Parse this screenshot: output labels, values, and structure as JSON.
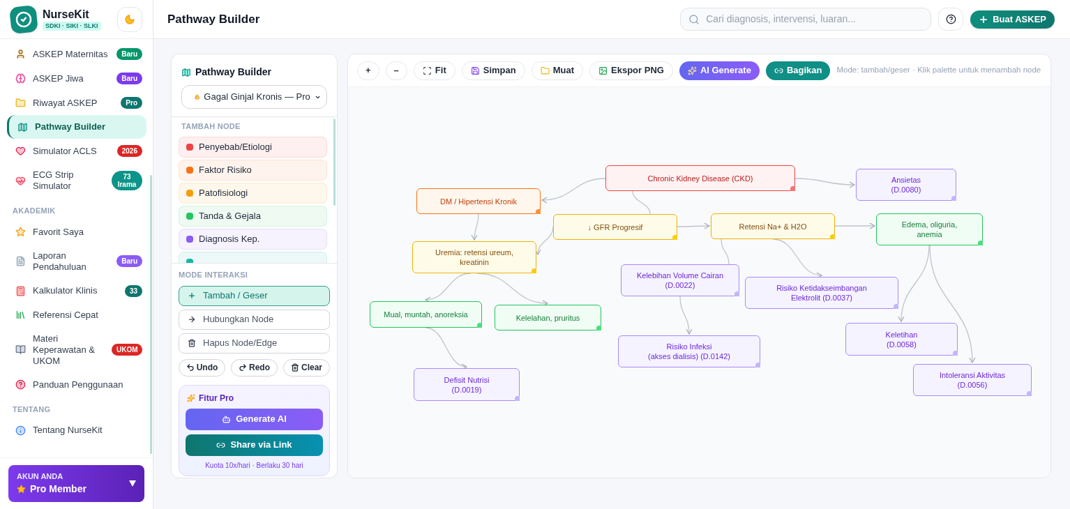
{
  "brand": {
    "name": "NurseKit",
    "tagline": "SDKI · SIKI · SLKI"
  },
  "sidebar": {
    "sections": [
      {
        "items": [
          {
            "label": "ASKEP Maternitas",
            "selected": false,
            "badge": {
              "text": "Baru",
              "color": "#059669"
            }
          },
          {
            "label": "ASKEP Jiwa",
            "selected": false,
            "badge": {
              "text": "Baru",
              "color": "#7c3aed"
            }
          },
          {
            "label": "Riwayat ASKEP",
            "selected": false,
            "badge": {
              "text": "Pro",
              "color": "#0f766e"
            }
          },
          {
            "label": "Pathway Builder",
            "selected": true
          },
          {
            "label": "Simulator ACLS",
            "selected": false,
            "badge": {
              "text": "2026",
              "color": "#dc2626"
            }
          },
          {
            "label": "ECG Strip Simulator",
            "selected": false,
            "badge": {
              "text": "73 Irama",
              "color": "#0d9488"
            }
          }
        ]
      },
      {
        "heading": "AKADEMIK",
        "items": [
          {
            "label": "Favorit Saya",
            "selected": false
          },
          {
            "label": "Laporan Pendahuluan",
            "selected": false,
            "badge": {
              "text": "Baru",
              "color": "#8b5cf6"
            }
          },
          {
            "label": "Kalkulator Klinis",
            "selected": false,
            "badge": {
              "text": "33",
              "color": "#0f766e"
            }
          },
          {
            "label": "Referensi Cepat",
            "selected": false
          },
          {
            "label": "Materi Keperawatan & UKOM",
            "selected": false,
            "badge": {
              "text": "UKOM",
              "color": "#dc2626"
            }
          },
          {
            "label": "Panduan Penggunaan",
            "selected": false
          }
        ]
      },
      {
        "heading": "TENTANG",
        "items": [
          {
            "label": "Tentang NurseKit",
            "selected": false
          }
        ]
      }
    ]
  },
  "account": {
    "heading": "AKUN ANDA",
    "plan": "Pro Member"
  },
  "header": {
    "title": "Pathway Builder",
    "search": {
      "placeholder": "Cari diagnosis, intervensi, luaran..."
    },
    "create_button": "Buat ASKEP"
  },
  "builder_panel": {
    "title": "Pathway Builder",
    "pathway_select": {
      "value": "Gagal Ginjal Kronis — Pro"
    },
    "palette": {
      "heading": "TAMBAH NODE",
      "items": [
        {
          "label": "Penyebab/Etiologi",
          "color": "#ef4444"
        },
        {
          "label": "Faktor Risiko",
          "color": "#f97316"
        },
        {
          "label": "Patofisiologi",
          "color": "#f59e0b"
        },
        {
          "label": "Tanda & Gejala",
          "color": "#22c55e"
        },
        {
          "label": "Diagnosis Kep.",
          "color": "#8b5cf6"
        },
        {
          "color": "#14b8a6"
        }
      ]
    },
    "modes": {
      "heading": "MODE INTERAKSI",
      "items": [
        {
          "label": "Tambah / Geser",
          "selected": true
        },
        {
          "label": "Hubungkan Node",
          "selected": false
        },
        {
          "label": "Hapus Node/Edge",
          "selected": false
        }
      ]
    },
    "history_buttons": [
      "Undo",
      "Redo",
      "Clear"
    ],
    "pro": {
      "title": "Fitur Pro",
      "buttons": [
        {
          "label": "Generate AI",
          "kind": "ai"
        },
        {
          "label": "Share via Link",
          "kind": "share"
        }
      ],
      "note": "Kuota 10x/hari · Berlaku 30 hari"
    }
  },
  "toolbar": {
    "buttons": [
      {
        "label": "+",
        "kind": "plain"
      },
      {
        "label": "–",
        "kind": "plain"
      },
      {
        "label": "Fit",
        "kind": "plain"
      },
      {
        "label": "Simpan",
        "kind": "plain"
      },
      {
        "label": "Muat",
        "kind": "plain"
      },
      {
        "label": "Ekspor PNG",
        "kind": "plain"
      },
      {
        "label": "AI Generate",
        "kind": "ai"
      },
      {
        "label": "Bagikan",
        "kind": "share"
      }
    ],
    "hint": "Mode: tambah/geser · Klik palette untuk menambah node"
  },
  "canvas": {
    "nodes": [
      {
        "kind": "etiologi",
        "lines": [
          "Chronic Kidney Disease (CKD)"
        ]
      },
      {
        "kind": "risiko",
        "lines": [
          "DM / Hipertensi Kronik"
        ]
      },
      {
        "kind": "patofisiologi",
        "lines": [
          "↓ GFR Progresif"
        ]
      },
      {
        "kind": "patofisiologi",
        "lines": [
          "Retensi Na+ & H2O"
        ]
      },
      {
        "kind": "patofisiologi",
        "lines": [
          "Uremia: retensi ureum,",
          "kreatinin"
        ]
      },
      {
        "kind": "diagnosis",
        "lines": [
          "Ansietas",
          "(D.0080)"
        ]
      },
      {
        "kind": "gejala",
        "lines": [
          "Edema, oliguria,",
          "anemia"
        ]
      },
      {
        "kind": "diagnosis",
        "lines": [
          "Kelebihan Volume Cairan",
          "(D.0022)"
        ]
      },
      {
        "kind": "diagnosis",
        "lines": [
          "Risiko Ketidakseimbangan",
          "Elektrolit (D.0037)"
        ]
      },
      {
        "kind": "gejala",
        "lines": [
          "Mual, muntah, anoreksia"
        ]
      },
      {
        "kind": "gejala",
        "lines": [
          "Kelelahan, pruritus"
        ]
      },
      {
        "kind": "diagnosis",
        "lines": [
          "Keletihan",
          "(D.0058)"
        ]
      },
      {
        "kind": "diagnosis",
        "lines": [
          "Risiko Infeksi",
          "(akses dialisis) (D.0142)"
        ]
      },
      {
        "kind": "diagnosis",
        "lines": [
          "Defisit Nutrisi",
          "(D.0019)"
        ]
      },
      {
        "kind": "diagnosis",
        "lines": [
          "Intoleransi Aktivitas",
          "(D.0056)"
        ]
      }
    ]
  }
}
